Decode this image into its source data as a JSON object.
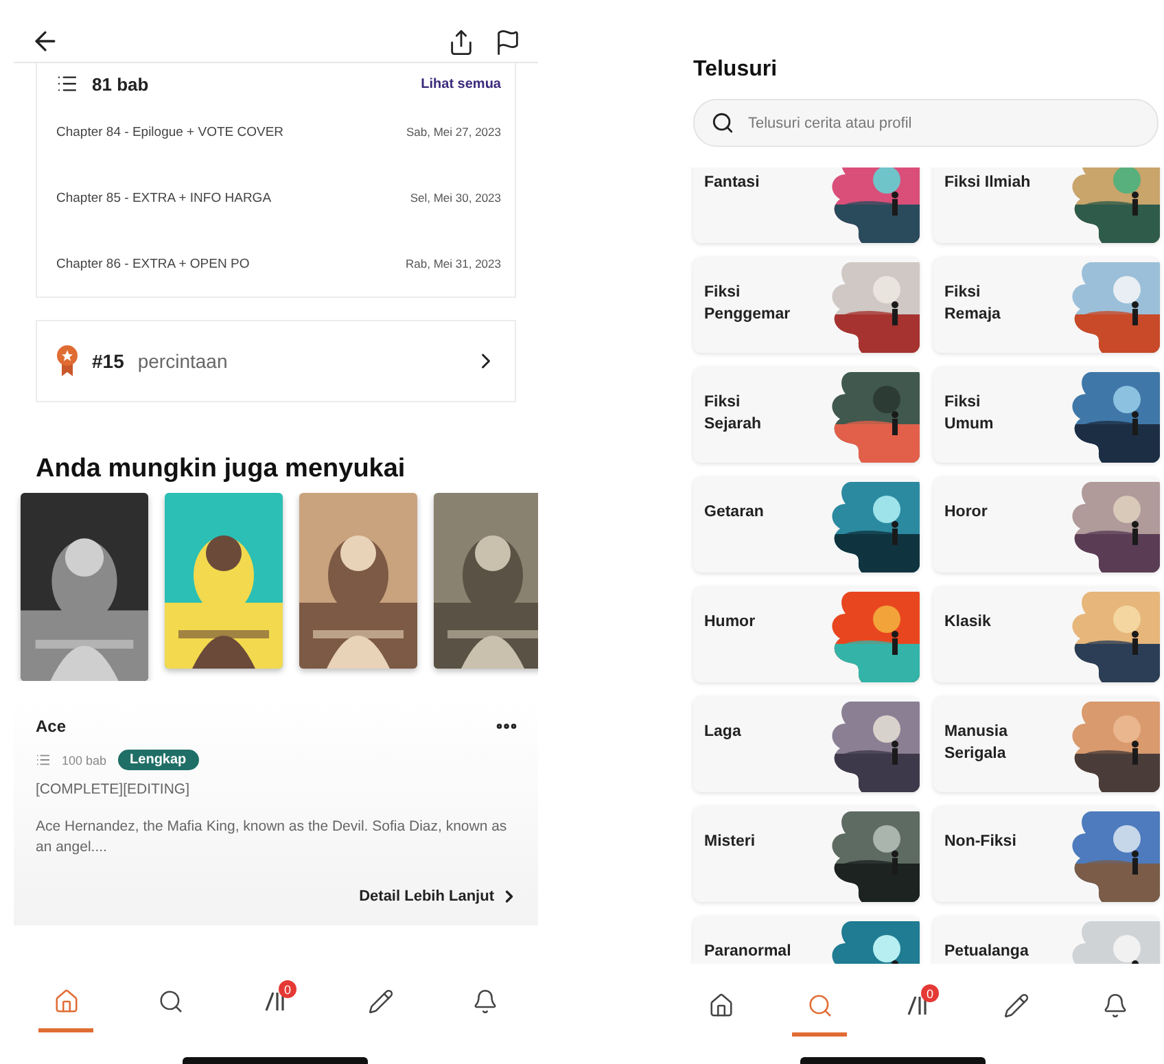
{
  "left_screen": {
    "chapters": {
      "count": "81 bab",
      "see_all": "Lihat semua",
      "items": [
        {
          "title": "Chapter 84 - Epilogue + VOTE COVER",
          "date": "Sab, Mei 27, 2023"
        },
        {
          "title": "Chapter 85 - EXTRA + INFO HARGA",
          "date": "Sel, Mei 30, 2023"
        },
        {
          "title": "Chapter 86 - EXTRA + OPEN PO",
          "date": "Rab, Mei 31, 2023"
        }
      ]
    },
    "ranking": {
      "rank": "#15",
      "tag": "percintaan"
    },
    "recommendations": {
      "heading": "Anda mungkin juga menyukai",
      "book": {
        "title": "Ace",
        "parts": "100 bab",
        "status": "Lengkap",
        "tags": "[COMPLETE][EDITING]",
        "description": "Ace Hernandez, the Mafia King, known as the Devil. Sofia Diaz, known as an angel....",
        "more": "Detail Lebih Lanjut"
      }
    },
    "nav": [
      {
        "kind": "home",
        "selected": true
      },
      {
        "kind": "search",
        "selected": false
      },
      {
        "kind": "library",
        "selected": false,
        "badge": "0"
      },
      {
        "kind": "write",
        "selected": false
      },
      {
        "kind": "notifications",
        "selected": false
      }
    ]
  },
  "right_screen": {
    "title": "Telusuri",
    "search": {
      "placeholder": "Telusuri cerita atau profil"
    },
    "categories": [
      {
        "label": "Fantasi"
      },
      {
        "label": "Fiksi Ilmiah"
      },
      {
        "label": "Fiksi Penggemar"
      },
      {
        "label": "Fiksi Remaja"
      },
      {
        "label": "Fiksi Sejarah"
      },
      {
        "label": "Fiksi Umum"
      },
      {
        "label": "Getaran"
      },
      {
        "label": "Horor"
      },
      {
        "label": "Humor"
      },
      {
        "label": "Klasik"
      },
      {
        "label": "Laga"
      },
      {
        "label": "Manusia Serigala"
      },
      {
        "label": "Misteri"
      },
      {
        "label": "Non-Fiksi"
      },
      {
        "label": "Paranormal"
      },
      {
        "label": "Petualanga"
      }
    ],
    "nav": [
      {
        "kind": "home",
        "selected": false
      },
      {
        "kind": "search",
        "selected": true
      },
      {
        "kind": "library",
        "selected": false,
        "badge": "0"
      },
      {
        "kind": "write",
        "selected": false
      },
      {
        "kind": "notifications",
        "selected": false
      }
    ]
  }
}
